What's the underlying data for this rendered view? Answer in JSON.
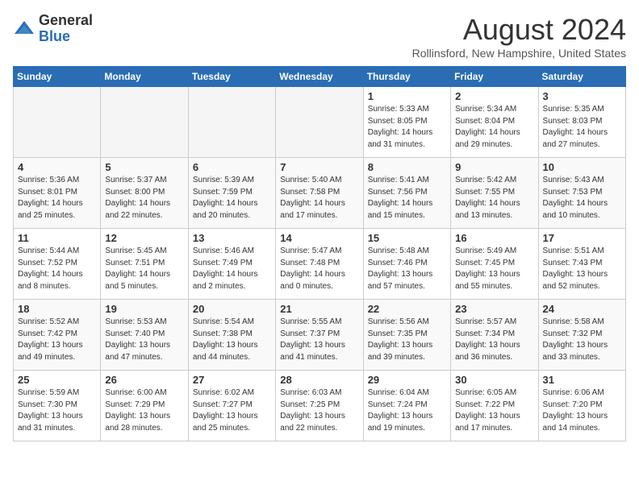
{
  "logo": {
    "general": "General",
    "blue": "Blue"
  },
  "header": {
    "month_year": "August 2024",
    "location": "Rollinsford, New Hampshire, United States"
  },
  "days_of_week": [
    "Sunday",
    "Monday",
    "Tuesday",
    "Wednesday",
    "Thursday",
    "Friday",
    "Saturday"
  ],
  "weeks": [
    [
      {
        "day": "",
        "info": ""
      },
      {
        "day": "",
        "info": ""
      },
      {
        "day": "",
        "info": ""
      },
      {
        "day": "",
        "info": ""
      },
      {
        "day": "1",
        "info": "Sunrise: 5:33 AM\nSunset: 8:05 PM\nDaylight: 14 hours\nand 31 minutes."
      },
      {
        "day": "2",
        "info": "Sunrise: 5:34 AM\nSunset: 8:04 PM\nDaylight: 14 hours\nand 29 minutes."
      },
      {
        "day": "3",
        "info": "Sunrise: 5:35 AM\nSunset: 8:03 PM\nDaylight: 14 hours\nand 27 minutes."
      }
    ],
    [
      {
        "day": "4",
        "info": "Sunrise: 5:36 AM\nSunset: 8:01 PM\nDaylight: 14 hours\nand 25 minutes."
      },
      {
        "day": "5",
        "info": "Sunrise: 5:37 AM\nSunset: 8:00 PM\nDaylight: 14 hours\nand 22 minutes."
      },
      {
        "day": "6",
        "info": "Sunrise: 5:39 AM\nSunset: 7:59 PM\nDaylight: 14 hours\nand 20 minutes."
      },
      {
        "day": "7",
        "info": "Sunrise: 5:40 AM\nSunset: 7:58 PM\nDaylight: 14 hours\nand 17 minutes."
      },
      {
        "day": "8",
        "info": "Sunrise: 5:41 AM\nSunset: 7:56 PM\nDaylight: 14 hours\nand 15 minutes."
      },
      {
        "day": "9",
        "info": "Sunrise: 5:42 AM\nSunset: 7:55 PM\nDaylight: 14 hours\nand 13 minutes."
      },
      {
        "day": "10",
        "info": "Sunrise: 5:43 AM\nSunset: 7:53 PM\nDaylight: 14 hours\nand 10 minutes."
      }
    ],
    [
      {
        "day": "11",
        "info": "Sunrise: 5:44 AM\nSunset: 7:52 PM\nDaylight: 14 hours\nand 8 minutes."
      },
      {
        "day": "12",
        "info": "Sunrise: 5:45 AM\nSunset: 7:51 PM\nDaylight: 14 hours\nand 5 minutes."
      },
      {
        "day": "13",
        "info": "Sunrise: 5:46 AM\nSunset: 7:49 PM\nDaylight: 14 hours\nand 2 minutes."
      },
      {
        "day": "14",
        "info": "Sunrise: 5:47 AM\nSunset: 7:48 PM\nDaylight: 14 hours\nand 0 minutes."
      },
      {
        "day": "15",
        "info": "Sunrise: 5:48 AM\nSunset: 7:46 PM\nDaylight: 13 hours\nand 57 minutes."
      },
      {
        "day": "16",
        "info": "Sunrise: 5:49 AM\nSunset: 7:45 PM\nDaylight: 13 hours\nand 55 minutes."
      },
      {
        "day": "17",
        "info": "Sunrise: 5:51 AM\nSunset: 7:43 PM\nDaylight: 13 hours\nand 52 minutes."
      }
    ],
    [
      {
        "day": "18",
        "info": "Sunrise: 5:52 AM\nSunset: 7:42 PM\nDaylight: 13 hours\nand 49 minutes."
      },
      {
        "day": "19",
        "info": "Sunrise: 5:53 AM\nSunset: 7:40 PM\nDaylight: 13 hours\nand 47 minutes."
      },
      {
        "day": "20",
        "info": "Sunrise: 5:54 AM\nSunset: 7:38 PM\nDaylight: 13 hours\nand 44 minutes."
      },
      {
        "day": "21",
        "info": "Sunrise: 5:55 AM\nSunset: 7:37 PM\nDaylight: 13 hours\nand 41 minutes."
      },
      {
        "day": "22",
        "info": "Sunrise: 5:56 AM\nSunset: 7:35 PM\nDaylight: 13 hours\nand 39 minutes."
      },
      {
        "day": "23",
        "info": "Sunrise: 5:57 AM\nSunset: 7:34 PM\nDaylight: 13 hours\nand 36 minutes."
      },
      {
        "day": "24",
        "info": "Sunrise: 5:58 AM\nSunset: 7:32 PM\nDaylight: 13 hours\nand 33 minutes."
      }
    ],
    [
      {
        "day": "25",
        "info": "Sunrise: 5:59 AM\nSunset: 7:30 PM\nDaylight: 13 hours\nand 31 minutes."
      },
      {
        "day": "26",
        "info": "Sunrise: 6:00 AM\nSunset: 7:29 PM\nDaylight: 13 hours\nand 28 minutes."
      },
      {
        "day": "27",
        "info": "Sunrise: 6:02 AM\nSunset: 7:27 PM\nDaylight: 13 hours\nand 25 minutes."
      },
      {
        "day": "28",
        "info": "Sunrise: 6:03 AM\nSunset: 7:25 PM\nDaylight: 13 hours\nand 22 minutes."
      },
      {
        "day": "29",
        "info": "Sunrise: 6:04 AM\nSunset: 7:24 PM\nDaylight: 13 hours\nand 19 minutes."
      },
      {
        "day": "30",
        "info": "Sunrise: 6:05 AM\nSunset: 7:22 PM\nDaylight: 13 hours\nand 17 minutes."
      },
      {
        "day": "31",
        "info": "Sunrise: 6:06 AM\nSunset: 7:20 PM\nDaylight: 13 hours\nand 14 minutes."
      }
    ]
  ]
}
